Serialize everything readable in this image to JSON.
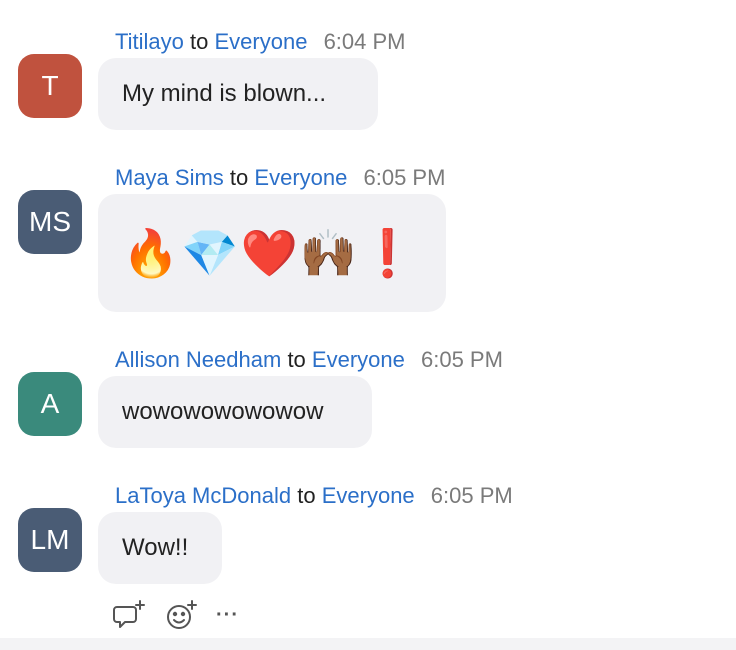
{
  "chat": {
    "messages": [
      {
        "sender": "Titilayo",
        "to_word": "to",
        "recipient": "Everyone",
        "time": "6:04 PM",
        "avatar": {
          "initials": "T",
          "color": "#c0523e"
        },
        "text": "My mind is blown..."
      },
      {
        "sender": "Maya Sims",
        "to_word": "to",
        "recipient": "Everyone",
        "time": "6:05 PM",
        "avatar": {
          "initials": "MS",
          "color": "#4a5c75"
        },
        "text": "🔥💎❤️🙌🏾❗"
      },
      {
        "sender": "Allison Needham",
        "to_word": "to",
        "recipient": "Everyone",
        "time": "6:05 PM",
        "avatar": {
          "initials": "A",
          "color": "#3a8a7c"
        },
        "text": "wowowowowowow"
      },
      {
        "sender": "LaToya McDonald",
        "to_word": "to",
        "recipient": "Everyone",
        "time": "6:05 PM",
        "avatar": {
          "initials": "LM",
          "color": "#4a5c75"
        },
        "text": "Wow!!"
      }
    ],
    "actions": {
      "reply_icon": "comment-plus-icon",
      "reaction_icon": "smiley-plus-icon",
      "more_icon": "ellipsis-icon",
      "more_label": "···"
    }
  }
}
